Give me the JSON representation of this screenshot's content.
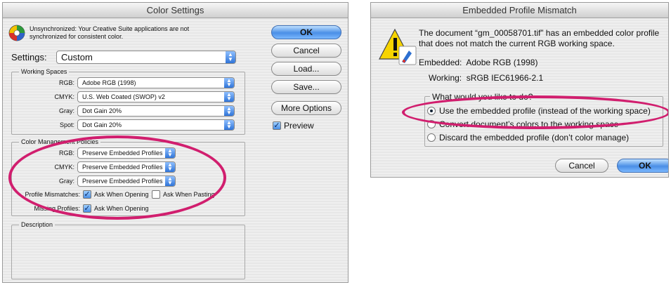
{
  "left_dialog": {
    "title": "Color Settings",
    "sync_message": "Unsynchronized: Your Creative Suite applications are not synchronized for consistent color.",
    "settings_label": "Settings:",
    "settings_value": "Custom",
    "working_spaces": {
      "legend": "Working Spaces",
      "rgb_label": "RGB:",
      "rgb_value": "Adobe RGB (1998)",
      "cmyk_label": "CMYK:",
      "cmyk_value": "U.S. Web Coated (SWOP) v2",
      "gray_label": "Gray:",
      "gray_value": "Dot Gain 20%",
      "spot_label": "Spot:",
      "spot_value": "Dot Gain 20%"
    },
    "policies": {
      "legend": "Color Management Policies",
      "rgb_label": "RGB:",
      "rgb_value": "Preserve Embedded Profiles",
      "cmyk_label": "CMYK:",
      "cmyk_value": "Preserve Embedded Profiles",
      "gray_label": "Gray:",
      "gray_value": "Preserve Embedded Profiles",
      "mismatch_label": "Profile Mismatches:",
      "ask_opening": "Ask When Opening",
      "ask_pasting": "Ask When Pasting",
      "missing_label": "Missing Profiles:",
      "missing_ask_opening": "Ask When Opening"
    },
    "description_legend": "Description",
    "buttons": {
      "ok": "OK",
      "cancel": "Cancel",
      "load": "Load...",
      "save": "Save...",
      "more_options": "More Options"
    },
    "preview_label": "Preview"
  },
  "right_dialog": {
    "title": "Embedded Profile Mismatch",
    "message": "The document “gm_00058701.tif” has an embedded color profile that does not match the current RGB working space.",
    "embedded": "Embedded:  Adobe RGB (1998)",
    "working": "Working:  sRGB IEC61966-2.1",
    "question": "What would you like to do?",
    "options": [
      "Use the embedded profile (instead of the working space)",
      "Convert document’s colors to the working space",
      "Discard the embedded profile (don’t color manage)"
    ],
    "cancel": "Cancel",
    "ok": "OK"
  }
}
